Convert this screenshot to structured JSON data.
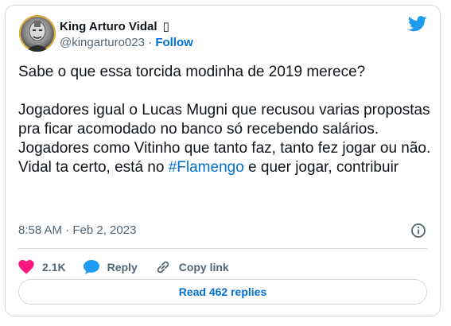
{
  "author": {
    "name": "King Arturo Vidal  ▯",
    "handle": "@kingarturo023",
    "separator": "·",
    "follow_label": "Follow"
  },
  "tweet": {
    "line1": "Sabe o que essa torcida modinha de 2019 merece?",
    "para2": "Jogadores igual o Lucas Mugni que recusou varias propostas pra ficar acomodado no banco só recebendo salários.",
    "para3": "Jogadores como Vitinho que tanto faz, tanto fez jogar ou não.",
    "para4_before": "Vidal ta certo, está no ",
    "hashtag": "#Flamengo",
    "para4_after": " e quer jogar, contribuir"
  },
  "meta": {
    "timestamp": "8:58 AM · Feb 2, 2023"
  },
  "actions": {
    "likes_count": "2.1K",
    "reply_label": "Reply",
    "copy_label": "Copy link"
  },
  "read_replies_label": "Read 462 replies",
  "colors": {
    "brand": "#1d9bf0",
    "link": "#006fd6",
    "heart": "#f91880",
    "muted": "#536471"
  },
  "icons": [
    "twitter-bird-icon",
    "info-icon",
    "heart-icon",
    "reply-bubble-icon",
    "link-icon"
  ]
}
